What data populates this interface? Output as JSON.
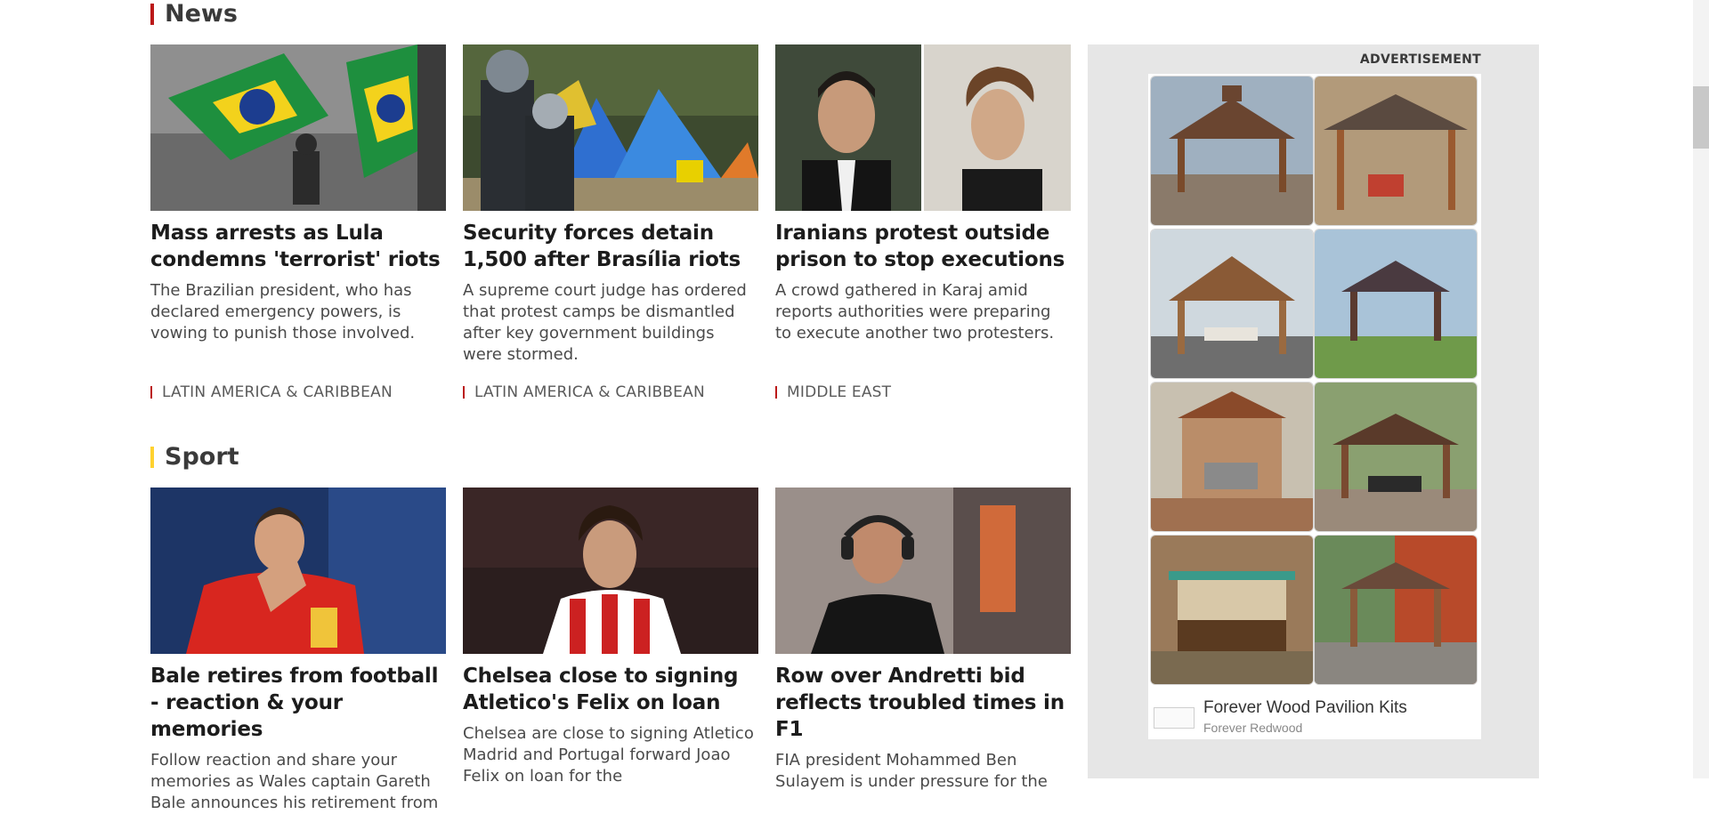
{
  "sections": {
    "news": {
      "title": "News",
      "accent": "#bb1919"
    },
    "sport": {
      "title": "Sport",
      "accent": "#ffd230"
    }
  },
  "news_cards": [
    {
      "headline": "Mass arrests as Lula condemns 'terrorist' riots",
      "summary": "The Brazilian president, who has declared emergency powers, is vowing to punish those involved.",
      "tag": "LATIN AMERICA & CARIBBEAN"
    },
    {
      "headline": "Security forces detain 1,500 after Brasília riots",
      "summary": "A supreme court judge has ordered that protest camps be dismantled after key government buildings were stormed.",
      "tag": "LATIN AMERICA & CARIBBEAN"
    },
    {
      "headline": "Iranians protest outside prison to stop executions",
      "summary": "A crowd gathered in Karaj amid reports authorities were preparing to execute another two protesters.",
      "tag": "MIDDLE EAST"
    }
  ],
  "sport_cards": [
    {
      "headline": "Bale retires from football - reaction & your memories",
      "summary": "Follow reaction and share your memories as Wales captain Gareth Bale announces his retirement from"
    },
    {
      "headline": "Chelsea close to signing Atletico's Felix on loan",
      "summary": "Chelsea are close to signing Atletico Madrid and Portugal forward Joao Felix on loan for the"
    },
    {
      "headline": "Row over Andretti bid reflects troubled times in F1",
      "summary": "FIA president Mohammed Ben Sulayem is under pressure for the"
    }
  ],
  "advertisement": {
    "label": "ADVERTISEMENT",
    "product_title": "Forever Wood Pavilion Kits",
    "advertiser": "Forever Redwood",
    "adchoices_icon": "adchoices-icon",
    "close_icon": "close-icon"
  },
  "colors": {
    "news_accent": "#bb1919",
    "sport_accent": "#ffd230",
    "ad_background": "#e6e6e6"
  }
}
